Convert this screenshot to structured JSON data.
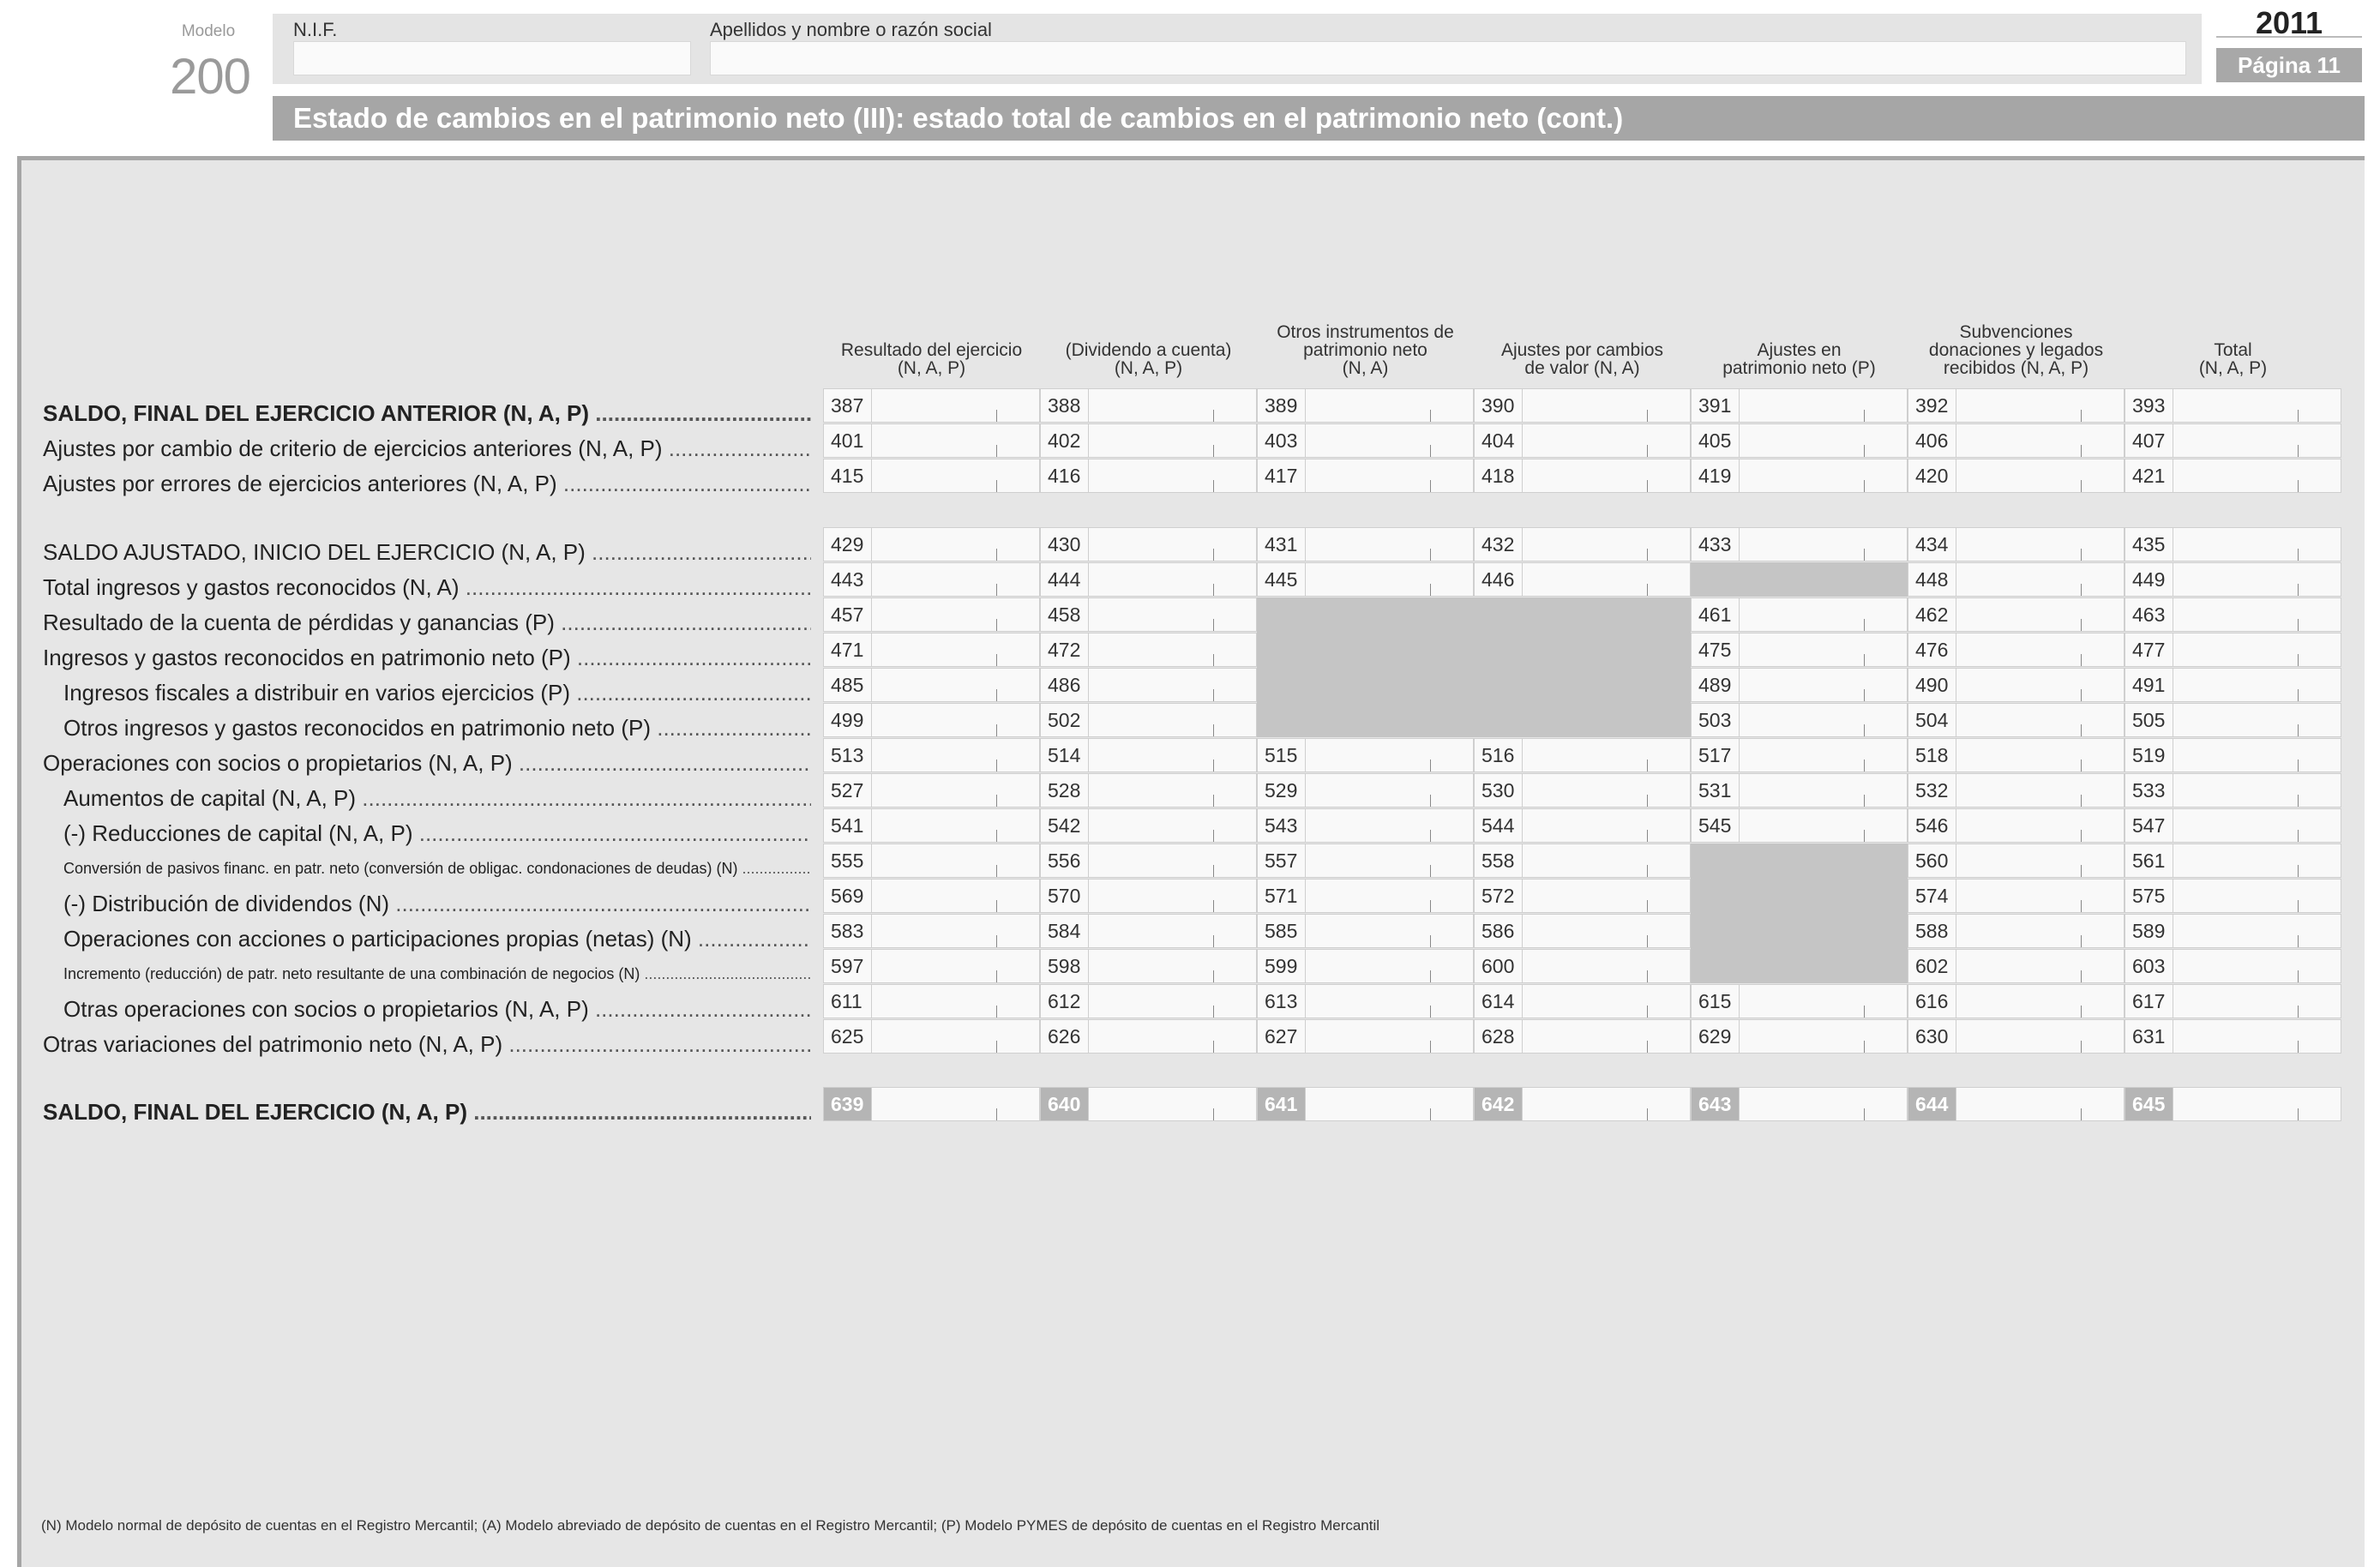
{
  "header": {
    "modelo_label": "Modelo",
    "modelo_number": "200",
    "nif_label": "N.I.F.",
    "name_label": "Apellidos y nombre o razón social",
    "year": "2011",
    "page": "Página 11",
    "title": "Estado de cambios en el patrimonio neto (III): estado total de cambios en el patrimonio neto (cont.)"
  },
  "columns": [
    {
      "lines": [
        "Resultado del ejercicio",
        "(N, A, P)"
      ]
    },
    {
      "lines": [
        "(Dividendo a cuenta)",
        "(N, A, P)"
      ]
    },
    {
      "lines": [
        "Otros instrumentos de",
        "patrimonio neto",
        "(N, A)"
      ]
    },
    {
      "lines": [
        "Ajustes por cambios",
        "de valor (N, A)"
      ]
    },
    {
      "lines": [
        "Ajustes en",
        "patrimonio neto (P)"
      ]
    },
    {
      "lines": [
        "Subvenciones",
        "donaciones y legados",
        "recibidos (N, A, P)"
      ]
    },
    {
      "lines": [
        "Total",
        "(N, A, P)"
      ]
    }
  ],
  "rows": [
    {
      "label": "SALDO, FINAL DEL EJERCICIO ANTERIOR (N, A, P)",
      "style": "bold",
      "indent": 0,
      "codes": [
        "387",
        "388",
        "389",
        "390",
        "391",
        "392",
        "393"
      ]
    },
    {
      "label": "Ajustes por cambio de criterio de ejercicios anteriores (N, A, P)",
      "style": "",
      "indent": 0,
      "codes": [
        "401",
        "402",
        "403",
        "404",
        "405",
        "406",
        "407"
      ]
    },
    {
      "label": "Ajustes por errores de ejercicios anteriores (N, A, P)",
      "style": "",
      "indent": 0,
      "codes": [
        "415",
        "416",
        "417",
        "418",
        "419",
        "420",
        "421"
      ]
    },
    {
      "label": "SALDO AJUSTADO, INICIO DEL EJERCICIO (N, A, P)",
      "style": "",
      "indent": 0,
      "codes": [
        "429",
        "430",
        "431",
        "432",
        "433",
        "434",
        "435"
      ]
    },
    {
      "label": "Total ingresos y gastos reconocidos (N, A)",
      "style": "",
      "indent": 0,
      "codes": [
        "443",
        "444",
        "445",
        "446",
        null,
        "448",
        "449"
      ]
    },
    {
      "label": "Resultado de la cuenta de pérdidas y ganancias (P)",
      "style": "",
      "indent": 0,
      "codes": [
        "457",
        "458",
        null,
        null,
        "461",
        "462",
        "463"
      ]
    },
    {
      "label": "Ingresos y gastos reconocidos en patrimonio neto (P)",
      "style": "",
      "indent": 0,
      "codes": [
        "471",
        "472",
        null,
        null,
        "475",
        "476",
        "477"
      ]
    },
    {
      "label": "Ingresos fiscales a distribuir en varios ejercicios (P)",
      "style": "",
      "indent": 1,
      "codes": [
        "485",
        "486",
        null,
        null,
        "489",
        "490",
        "491"
      ]
    },
    {
      "label": "Otros ingresos y gastos reconocidos en patrimonio neto (P)",
      "style": "",
      "indent": 1,
      "codes": [
        "499",
        "502",
        null,
        null,
        "503",
        "504",
        "505"
      ]
    },
    {
      "label": "Operaciones con socios o propietarios (N, A, P)",
      "style": "",
      "indent": 0,
      "codes": [
        "513",
        "514",
        "515",
        "516",
        "517",
        "518",
        "519"
      ]
    },
    {
      "label": "Aumentos de capital (N, A, P)",
      "style": "",
      "indent": 1,
      "codes": [
        "527",
        "528",
        "529",
        "530",
        "531",
        "532",
        "533"
      ]
    },
    {
      "label": "(-) Reducciones de capital (N, A, P)",
      "style": "",
      "indent": 1,
      "codes": [
        "541",
        "542",
        "543",
        "544",
        "545",
        "546",
        "547"
      ]
    },
    {
      "label": "Conversión de pasivos financ. en patr. neto (conversión de obligac. condonaciones de deudas) (N)",
      "style": "small",
      "indent": 1,
      "codes": [
        "555",
        "556",
        "557",
        "558",
        null,
        "560",
        "561"
      ]
    },
    {
      "label": "(-) Distribución de dividendos (N)",
      "style": "",
      "indent": 1,
      "codes": [
        "569",
        "570",
        "571",
        "572",
        null,
        "574",
        "575"
      ]
    },
    {
      "label": "Operaciones con acciones o participaciones propias (netas) (N)",
      "style": "",
      "indent": 1,
      "codes": [
        "583",
        "584",
        "585",
        "586",
        null,
        "588",
        "589"
      ]
    },
    {
      "label": "Incremento (reducción) de patr. neto resultante de una combinación de negocios (N)",
      "style": "small",
      "indent": 1,
      "codes": [
        "597",
        "598",
        "599",
        "600",
        null,
        "602",
        "603"
      ]
    },
    {
      "label": "Otras operaciones con socios o propietarios (N, A, P)",
      "style": "",
      "indent": 1,
      "codes": [
        "611",
        "612",
        "613",
        "614",
        "615",
        "616",
        "617"
      ]
    },
    {
      "label": "Otras variaciones del patrimonio neto (N, A, P)",
      "style": "",
      "indent": 0,
      "codes": [
        "625",
        "626",
        "627",
        "628",
        "629",
        "630",
        "631"
      ]
    },
    {
      "label": "SALDO, FINAL DEL EJERCICIO (N, A, P)",
      "style": "bold",
      "indent": 0,
      "final": true,
      "codes": [
        "639",
        "640",
        "641",
        "642",
        "643",
        "644",
        "645"
      ]
    }
  ],
  "footnote": "(N)   Modelo normal de depósito de cuentas en el Registro Mercantil; (A) Modelo abreviado de depósito de cuentas en el Registro Mercantil; (P) Modelo PYMES de depósito de cuentas en el Registro Mercantil"
}
